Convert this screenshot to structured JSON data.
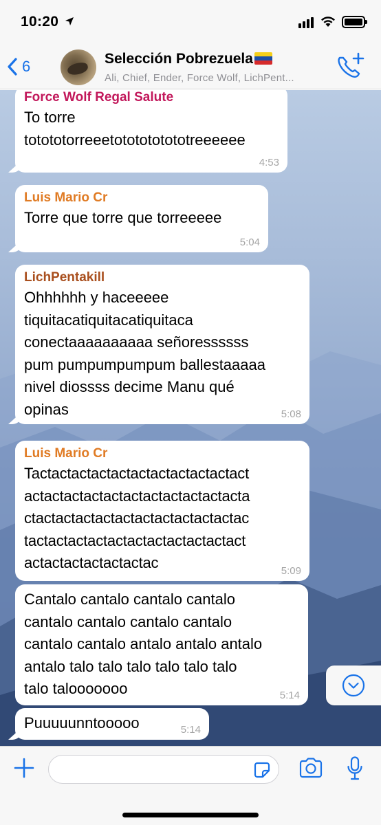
{
  "status_bar": {
    "time": "10:20",
    "icons": [
      "location-arrow-icon",
      "cellular-signal-icon",
      "wifi-icon",
      "battery-icon"
    ]
  },
  "header": {
    "back_count": "6",
    "group_name": "Selección Pobrezuela",
    "members": "Ali, Chief, Ender, Force Wolf, LichPent...",
    "icons": [
      "back-chevron-icon",
      "flag-venezuela-icon",
      "add-call-icon"
    ]
  },
  "colors": {
    "accent": "#1a73e8",
    "sender_pink": "#c2185b",
    "sender_orange": "#e07b24",
    "sender_brown": "#a94f1e"
  },
  "messages": [
    {
      "sender": "Force Wolf Regal Salute",
      "text": "To torre\ntotototorreeetototototototreeeeee",
      "time": "4:53"
    },
    {
      "sender": "Luis Mario Cr",
      "text": "Torre que torre que torreeeee",
      "time": "5:04"
    },
    {
      "sender": "LichPentakill",
      "text": "Ohhhhhh y haceeeee\ntiquitacatiquitacatiquitaca\nconectaaaaaaaaaa señoressssss\npum pumpumpumpum ballestaaaaa\nnivel diossss decime Manu qué\nopinas",
      "time": "5:08"
    },
    {
      "sender": "Luis Mario Cr",
      "text": "Tactactactactactactactactactactact\nactactactactactactactactactactacta\nctactactactactactactactactactactac\ntactactactactactactactactactactact\nactactactactactactac",
      "time": "5:09"
    },
    {
      "sender": "",
      "text": "Cantalo cantalo cantalo cantalo\ncantalo cantalo cantalo cantalo\ncantalo cantalo antalo antalo antalo\nantalo talo talo talo talo talo talo\ntalo talooooooo",
      "time": "5:14"
    },
    {
      "sender": "",
      "text": "Puuuuunntooooo",
      "time": "5:14"
    }
  ],
  "input_bar": {
    "placeholder": "",
    "icons": [
      "plus-icon",
      "sticker-icon",
      "camera-icon",
      "microphone-icon"
    ]
  },
  "scroll_down": {
    "icon": "chevron-down-circle-icon"
  }
}
